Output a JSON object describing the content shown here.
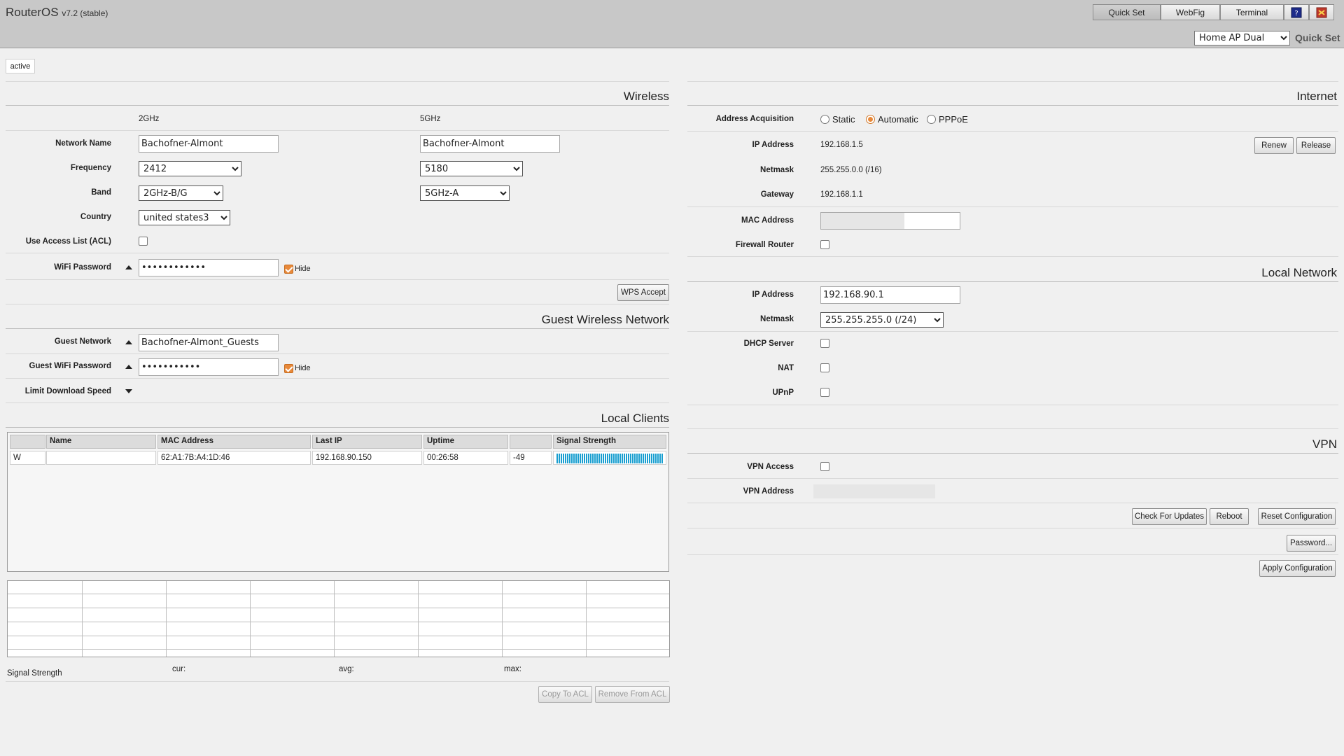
{
  "header": {
    "brand": "RouterOS",
    "version": "v7.2 (stable)",
    "nav": [
      "Quick Set",
      "WebFig",
      "Terminal"
    ],
    "mode": "Home AP Dual",
    "quick_set_label": "Quick Set"
  },
  "status_tab": "active",
  "wireless": {
    "title": "Wireless",
    "col_2ghz": "2GHz",
    "col_5ghz": "5GHz",
    "labels": {
      "network_name": "Network Name",
      "frequency": "Frequency",
      "band": "Band",
      "country": "Country",
      "acl": "Use Access List (ACL)",
      "wifi_password": "WiFi Password"
    },
    "network_name_2": "Bachofner-Almont",
    "network_name_5": "Bachofner-Almont",
    "frequency_2": "2412",
    "frequency_5": "5180",
    "band_2": "2GHz-B/G",
    "band_5": "5GHz-A",
    "country": "united states3",
    "acl_checked": false,
    "wifi_password": "••••••••••••",
    "hide_label": "Hide",
    "wps_accept": "WPS Accept"
  },
  "guest": {
    "title": "Guest Wireless Network",
    "labels": {
      "guest_network": "Guest Network",
      "guest_password": "Guest WiFi Password",
      "limit_speed": "Limit Download Speed"
    },
    "guest_network": "Bachofner-Almont_Guests",
    "guest_password": "•••••••••••",
    "hide_label": "Hide"
  },
  "clients": {
    "title": "Local Clients",
    "columns": [
      "",
      "Name",
      "MAC Address",
      "Last IP",
      "Uptime",
      "",
      "Signal Strength"
    ],
    "rows": [
      {
        "type": "W",
        "name": "",
        "mac": "62:A1:7B:A4:1D:46",
        "last_ip": "192.168.90.150",
        "uptime": "00:26:58",
        "signal": "-49",
        "signal_level": 1.0
      }
    ]
  },
  "signal_stats": {
    "label": "Signal Strength",
    "cur": "cur:",
    "avg": "avg:",
    "max": "max:"
  },
  "acl_buttons": {
    "copy": "Copy To ACL",
    "remove": "Remove From ACL"
  },
  "internet": {
    "title": "Internet",
    "labels": {
      "address_acquisition": "Address Acquisition",
      "ip_address": "IP Address",
      "netmask": "Netmask",
      "gateway": "Gateway",
      "mac_address": "MAC Address",
      "firewall_router": "Firewall Router"
    },
    "acquisition_options": [
      "Static",
      "Automatic",
      "PPPoE"
    ],
    "acquisition_selected": "Automatic",
    "ip_address": "192.168.1.5",
    "netmask": "255.255.0.0 (/16)",
    "gateway": "192.168.1.1",
    "mac_address": "",
    "firewall_router_checked": false,
    "renew": "Renew",
    "release": "Release"
  },
  "local_network": {
    "title": "Local Network",
    "labels": {
      "ip_address": "IP Address",
      "netmask": "Netmask",
      "dhcp_server": "DHCP Server",
      "nat": "NAT",
      "upnp": "UPnP"
    },
    "ip_address": "192.168.90.1",
    "netmask": "255.255.255.0 (/24)"
  },
  "vpn": {
    "title": "VPN",
    "labels": {
      "vpn_access": "VPN Access",
      "vpn_address": "VPN Address"
    }
  },
  "actions": {
    "check_updates": "Check For Updates",
    "reboot": "Reboot",
    "reset": "Reset Configuration",
    "password": "Password...",
    "apply": "Apply Configuration"
  },
  "colors": {
    "signal_bar": "#1a9fd0",
    "checkbox_accent": "#e8893a"
  }
}
